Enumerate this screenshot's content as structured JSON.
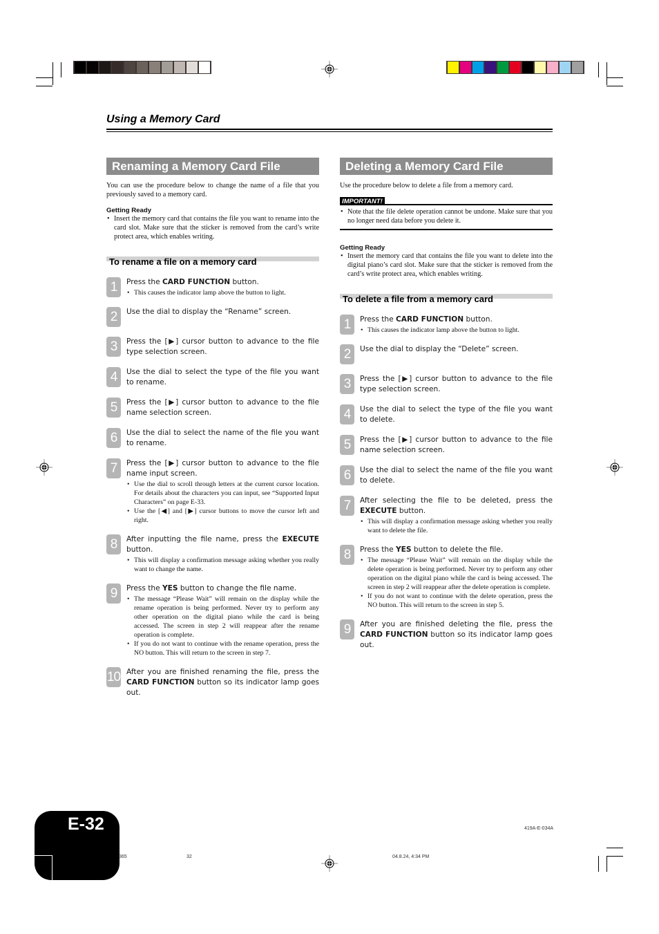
{
  "print_marks": {
    "gray_swatches": [
      "#000000",
      "#050303",
      "#1c1816",
      "#352c29",
      "#4e4541",
      "#6b625c",
      "#898079",
      "#a39d98",
      "#c0b7b3",
      "#e2ddda",
      "#ffffff"
    ],
    "color_swatches": [
      "#fff100",
      "#e4007f",
      "#00a0e9",
      "#3a117d",
      "#009a3e",
      "#e60020",
      "#000000",
      "#fff9ab",
      "#f8afc9",
      "#9fd5f3",
      "#a0a0a0"
    ]
  },
  "running_header": "Using a Memory Card",
  "left": {
    "title": "Renaming a Memory Card File",
    "intro": "You can use the procedure below to change the name of a file that you previously saved to a memory card.",
    "getting_ready_title": "Getting Ready",
    "getting_ready": [
      "Insert the memory card that contains the file you want to rename into the card slot. Make sure that the sticker is removed from the card’s write protect area, which enables writing."
    ],
    "procedure_title": "To rename a file on a memory card",
    "steps": [
      {
        "num": "1",
        "text": [
          "Press the ",
          {
            "b": "CARD FUNCTION"
          },
          " button."
        ],
        "notes": [
          "This causes the indicator lamp above the button to light."
        ]
      },
      {
        "num": "2",
        "text": [
          "Use the dial to display the “Rename” screen."
        ],
        "notes": []
      },
      {
        "num": "3",
        "text": [
          "Press the [▶] cursor button to advance to the file type selection screen."
        ],
        "notes": []
      },
      {
        "num": "4",
        "text": [
          "Use the dial to select the type of the file you want to rename."
        ],
        "notes": []
      },
      {
        "num": "5",
        "text": [
          "Press the [▶] cursor button to advance to the file name selection screen."
        ],
        "notes": []
      },
      {
        "num": "6",
        "text": [
          "Use the dial to select the name of the file you want to rename."
        ],
        "notes": []
      },
      {
        "num": "7",
        "text": [
          "Press the [▶] cursor button to advance to the file name input screen."
        ],
        "notes": [
          "Use the dial to scroll through letters at the current cursor location. For details about the characters you can input, see “Supported Input Characters” on page E-33.",
          "Use the [◀] and [▶] cursor buttons to move the cursor left and right."
        ]
      },
      {
        "num": "8",
        "text": [
          "After inputting the file name, press the ",
          {
            "b": "EXECUTE"
          },
          " button."
        ],
        "notes": [
          "This will display a confirmation message asking whether you really want to change the name."
        ]
      },
      {
        "num": "9",
        "text": [
          "Press the ",
          {
            "b": "YES"
          },
          " button to change the file name."
        ],
        "notes": [
          "The message “Please Wait” will remain on the display while the rename operation is being performed. Never try to perform any other operation on the digital piano while the card is being accessed. The screen in step 2 will reappear after the rename operation is complete.",
          "If you do not want to continue with the rename operation, press the NO button. This will return to the screen in step 7."
        ]
      },
      {
        "num": "10",
        "text": [
          "After you are finished renaming the file, press the ",
          {
            "b": "CARD FUNCTION"
          },
          " button so its indicator lamp goes out."
        ],
        "notes": []
      }
    ]
  },
  "right": {
    "title": "Deleting a Memory Card File",
    "intro": "Use the procedure below to delete a file from a memory card.",
    "important_label": "IMPORTANT!",
    "important": [
      "Note that the file delete operation cannot be undone. Make sure that you no longer need data before you delete it."
    ],
    "getting_ready_title": "Getting Ready",
    "getting_ready": [
      "Insert the memory card that contains the file you want to delete into the digital piano’s card slot. Make sure that the sticker is removed from the card’s write protect area, which enables writing."
    ],
    "procedure_title": "To delete a file from a memory card",
    "steps": [
      {
        "num": "1",
        "text": [
          "Press the ",
          {
            "b": "CARD FUNCTION"
          },
          " button."
        ],
        "notes": [
          "This causes the indicator lamp above the button to light."
        ]
      },
      {
        "num": "2",
        "text": [
          "Use the dial to display the “Delete” screen."
        ],
        "notes": []
      },
      {
        "num": "3",
        "text": [
          "Press the [▶] cursor button to advance to the file type selection screen."
        ],
        "notes": []
      },
      {
        "num": "4",
        "text": [
          "Use the dial to select the type of the file you want to delete."
        ],
        "notes": []
      },
      {
        "num": "5",
        "text": [
          "Press the [▶] cursor button to advance to the file name selection screen."
        ],
        "notes": []
      },
      {
        "num": "6",
        "text": [
          "Use the dial to select the name of the file you want to delete."
        ],
        "notes": []
      },
      {
        "num": "7",
        "text": [
          "After selecting the file to be deleted, press the ",
          {
            "b": "EXECUTE"
          },
          " button."
        ],
        "notes": [
          "This will display a confirmation message asking whether you really want to delete the file."
        ]
      },
      {
        "num": "8",
        "text": [
          "Press the ",
          {
            "b": "YES"
          },
          " button to delete the file."
        ],
        "notes": [
          "The message “Please Wait” will remain on the display while the delete operation is being performed. Never try to perform any other operation on the digital piano while the card is being accessed. The screen in step 2 will reappear after the delete operation is complete.",
          "If you do not want to continue with the delete operation, press the NO button. This will return to the screen in step 5."
        ]
      },
      {
        "num": "9",
        "text": [
          "After you are finished deleting the file, press the ",
          {
            "b": "CARD FUNCTION"
          },
          " button so its indicator lamp goes out."
        ],
        "notes": []
      }
    ]
  },
  "footer": {
    "page_number": "E-32",
    "doc_code": "419A-E-034A",
    "slug_left": "365",
    "slug_page": "32",
    "slug_date": "04.8.24, 4:34 PM"
  }
}
